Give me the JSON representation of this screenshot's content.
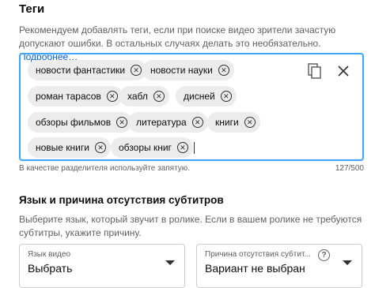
{
  "section": {
    "title": "Теги",
    "description": "Рекомендуем добавлять теги, если при поиске видео зрители зачастую допускают ошибки. В остальных случаях делать это необязательно.",
    "more_link": "Подробнее…"
  },
  "tags": [
    {
      "label": "новости фантастики"
    },
    {
      "label": "новости науки"
    },
    {
      "label": "роман тарасов"
    },
    {
      "label": "хабл"
    },
    {
      "label": "дисней"
    },
    {
      "label": "обзоры фильмов"
    },
    {
      "label": "литература"
    },
    {
      "label": "книги"
    },
    {
      "label": "новые книги"
    },
    {
      "label": "обзоры книг"
    }
  ],
  "tag_input": {
    "hint": "В качестве разделителя используйте запятую.",
    "counter": "127/500",
    "copy_icon": "copy-icon",
    "clear_icon": "close-icon",
    "remove_icon": "close-circle-icon"
  },
  "subtitles": {
    "title": "Язык и причина отсутствия субтитров",
    "description": "Выберите язык, который звучит в ролике. Если в вашем ролике не требуются субтитры, укажите причину.",
    "language_select": {
      "label": "Язык видео",
      "value": "Выбрать"
    },
    "reason_select": {
      "label": "Причина отсутствия субтит...",
      "value": "Вариант не выбран",
      "help_icon": "?"
    }
  },
  "colors": {
    "focus_border": "#3ea6ff",
    "link": "#065fd4",
    "chip_bg": "#ececec",
    "secondary_text": "#606060"
  }
}
